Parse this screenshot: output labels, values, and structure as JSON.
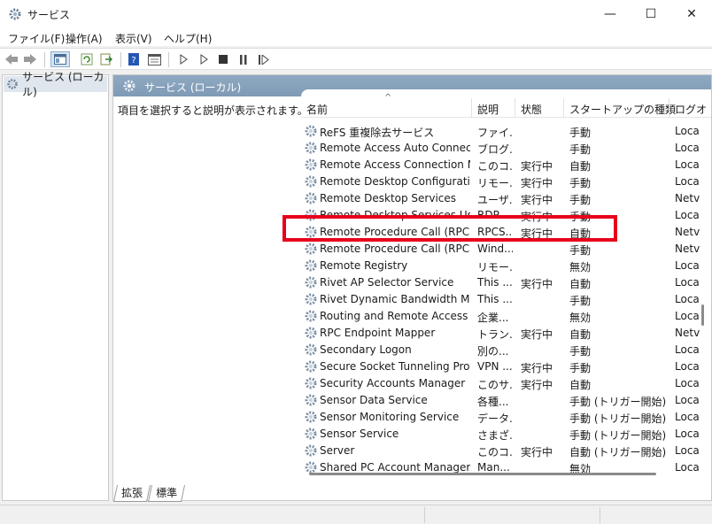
{
  "window": {
    "title": "サービス",
    "buttons": {
      "minimize": "—",
      "maximize": "☐",
      "close": "✕"
    }
  },
  "menu": [
    "ファイル(F)",
    "操作(A)",
    "表示(V)",
    "ヘルプ(H)"
  ],
  "tree": {
    "root_label": "サービス (ローカル)"
  },
  "main": {
    "header_title": "サービス (ローカル)",
    "description_hint": "項目を選択すると説明が表示されます。",
    "columns": {
      "name": "名前",
      "description": "説明",
      "status": "状態",
      "startup": "スタートアップの種類",
      "logon": "ログオ"
    },
    "rows": [
      {
        "name": "ReFS 重複除去サービス",
        "description": "ファイ...",
        "status": "",
        "startup": "手動",
        "logon": "Loca"
      },
      {
        "name": "Remote Access Auto Connecti...",
        "description": "ブログ...",
        "status": "",
        "startup": "手動",
        "logon": "Loca"
      },
      {
        "name": "Remote Access Connection M...",
        "description": "このコ...",
        "status": "実行中",
        "startup": "自動",
        "logon": "Loca"
      },
      {
        "name": "Remote Desktop Configuration",
        "description": "リモー...",
        "status": "実行中",
        "startup": "手動",
        "logon": "Loca"
      },
      {
        "name": "Remote Desktop Services",
        "description": "ユーザ...",
        "status": "実行中",
        "startup": "手動",
        "logon": "Netv"
      },
      {
        "name": "Remote Desktop Services User...",
        "description": "RDP ...",
        "status": "実行中",
        "startup": "手動",
        "logon": "Loca"
      },
      {
        "name": "Remote Procedure Call (RPC)",
        "description": "RPCS...",
        "status": "実行中",
        "startup": "自動",
        "logon": "Netv"
      },
      {
        "name": "Remote Procedure Call (RPC) L...",
        "description": "Wind...",
        "status": "",
        "startup": "手動",
        "logon": "Netv"
      },
      {
        "name": "Remote Registry",
        "description": "リモー...",
        "status": "",
        "startup": "無効",
        "logon": "Loca"
      },
      {
        "name": "Rivet AP Selector Service",
        "description": "This ...",
        "status": "実行中",
        "startup": "自動",
        "logon": "Loca"
      },
      {
        "name": "Rivet Dynamic Bandwidth Ma...",
        "description": "This ...",
        "status": "",
        "startup": "手動",
        "logon": "Loca"
      },
      {
        "name": "Routing and Remote Access",
        "description": "企業...",
        "status": "",
        "startup": "無効",
        "logon": "Loca"
      },
      {
        "name": "RPC Endpoint Mapper",
        "description": "トラン...",
        "status": "実行中",
        "startup": "自動",
        "logon": "Netv"
      },
      {
        "name": "Secondary Logon",
        "description": "別の...",
        "status": "",
        "startup": "手動",
        "logon": "Loca"
      },
      {
        "name": "Secure Socket Tunneling Proto...",
        "description": "VPN ...",
        "status": "実行中",
        "startup": "手動",
        "logon": "Loca"
      },
      {
        "name": "Security Accounts Manager",
        "description": "このサ...",
        "status": "実行中",
        "startup": "自動",
        "logon": "Loca"
      },
      {
        "name": "Sensor Data Service",
        "description": "各種...",
        "status": "",
        "startup": "手動 (トリガー開始)",
        "logon": "Loca"
      },
      {
        "name": "Sensor Monitoring Service",
        "description": "データ...",
        "status": "",
        "startup": "手動 (トリガー開始)",
        "logon": "Loca"
      },
      {
        "name": "Sensor Service",
        "description": "さまざ...",
        "status": "",
        "startup": "手動 (トリガー開始)",
        "logon": "Loca"
      },
      {
        "name": "Server",
        "description": "このコ...",
        "status": "実行中",
        "startup": "自動 (トリガー開始)",
        "logon": "Loca"
      },
      {
        "name": "Shared PC Account Manager",
        "description": "Man...",
        "status": "",
        "startup": "無効",
        "logon": "Loca"
      }
    ]
  },
  "tabs": [
    "拡張",
    "標準"
  ],
  "colors": {
    "highlight": "#e8001a",
    "header_bg": "#8fa9c2",
    "selected_tree_bg": "#dfe6ee"
  }
}
